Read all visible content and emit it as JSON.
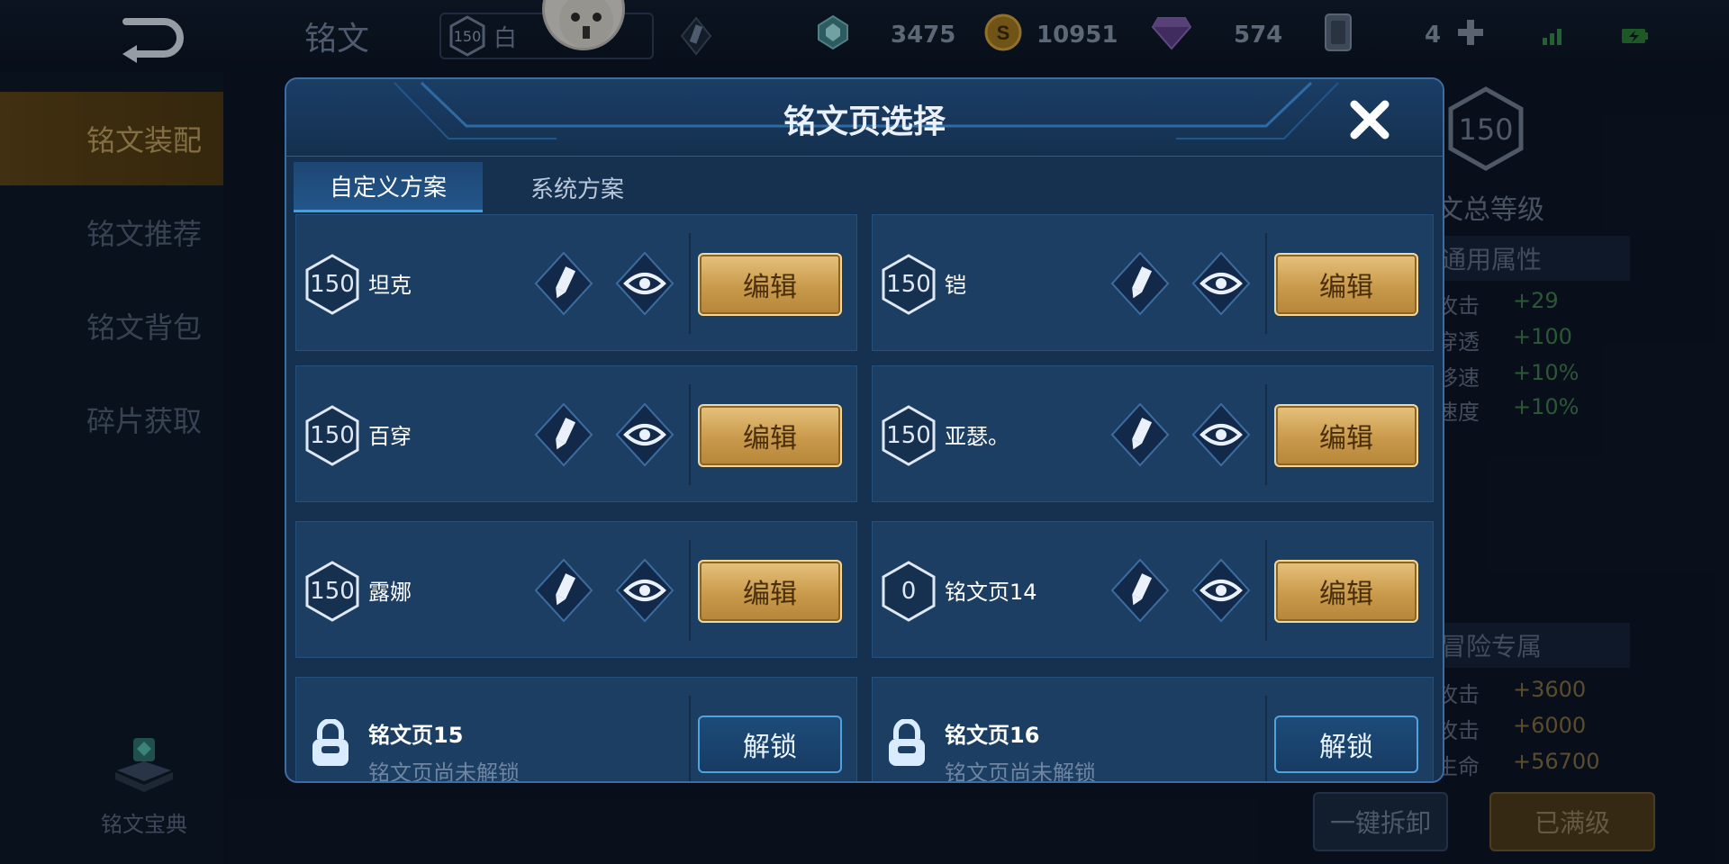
{
  "topbar": {
    "title": "铭文",
    "level": "150",
    "player_name": "白",
    "gems": "3475",
    "gold": "10951",
    "diamonds": "574",
    "cards": "4"
  },
  "sidebar": {
    "items": [
      {
        "label": "铭文装配"
      },
      {
        "label": "铭文推荐"
      },
      {
        "label": "铭文背包"
      },
      {
        "label": "碎片获取"
      }
    ],
    "codex_label": "铭文宝典"
  },
  "background_panel": {
    "level": "150",
    "total_label": "文总等级",
    "general_header": "通用属性",
    "general_stats": [
      {
        "name": "攻击",
        "value": "+29"
      },
      {
        "name": "穿透",
        "value": "+100"
      },
      {
        "name": "移速",
        "value": "+10%"
      },
      {
        "name": "速度",
        "value": "+10%"
      }
    ],
    "adventure_header": "冒险专属",
    "adventure_stats": [
      {
        "name": "攻击",
        "value": "+3600"
      },
      {
        "name": "攻击",
        "value": "+6000"
      },
      {
        "name": "生命",
        "value": "+56700"
      }
    ],
    "disassemble_label": "一键拆卸",
    "maxed_label": "已满级"
  },
  "modal": {
    "title": "铭文页选择",
    "tabs": [
      {
        "label": "自定义方案"
      },
      {
        "label": "系统方案"
      }
    ],
    "edit_label": "编辑",
    "unlock_label": "解锁",
    "locked_subtitle": "铭文页尚未解锁",
    "pages": [
      {
        "level": "150",
        "name": "坦克"
      },
      {
        "level": "150",
        "name": "铠"
      },
      {
        "level": "150",
        "name": "百穿"
      },
      {
        "level": "150",
        "name": "亚瑟。"
      },
      {
        "level": "150",
        "name": "露娜"
      },
      {
        "level": "0",
        "name": "铭文页14"
      }
    ],
    "locked_pages": [
      {
        "name": "铭文页15"
      },
      {
        "name": "铭文页16"
      }
    ]
  },
  "colors": {
    "modal_bg": "#16304f",
    "card_bg": "#1d3e63",
    "gold_button": "#c99a4b",
    "accent_blue": "#3aa2e8"
  }
}
